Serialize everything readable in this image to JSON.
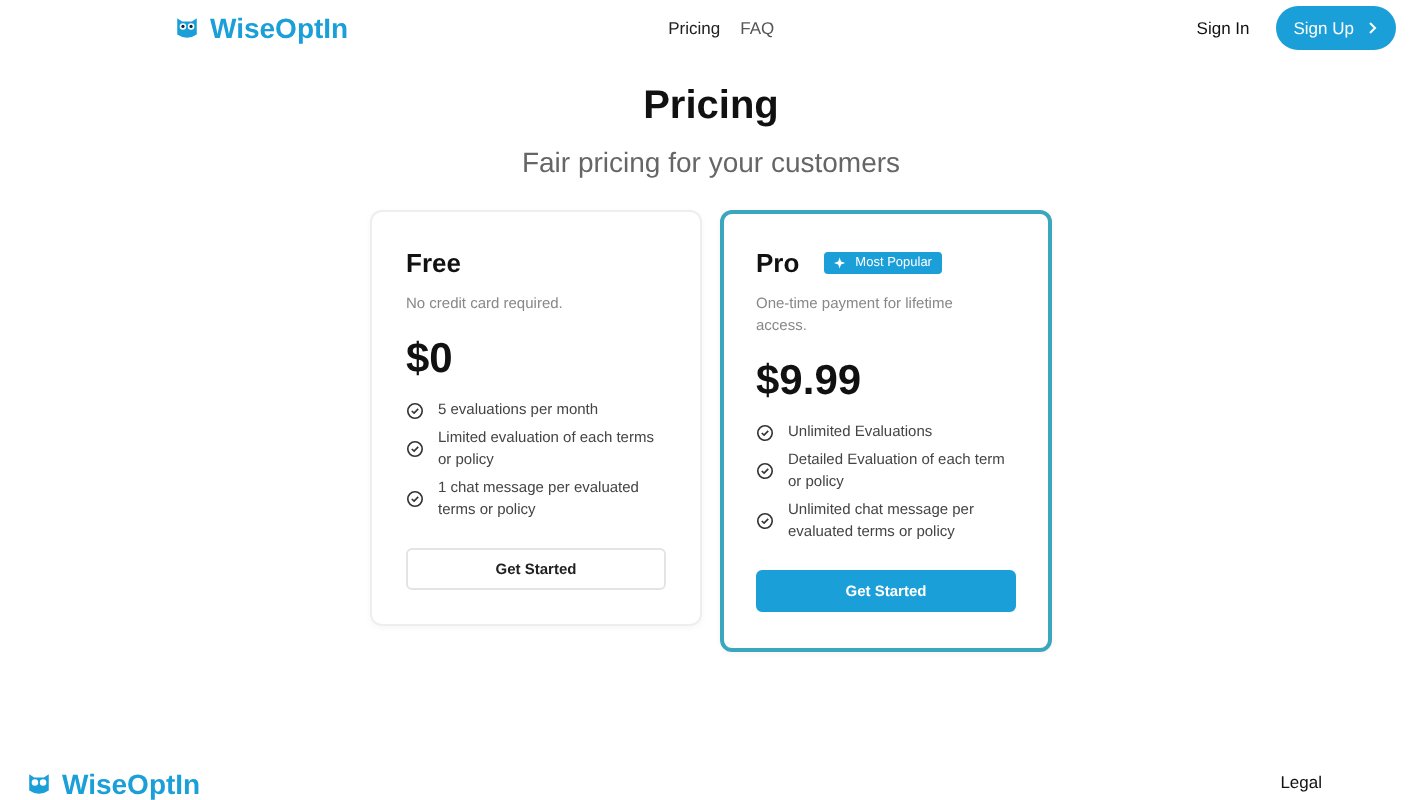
{
  "header": {
    "brand": "WiseOptIn",
    "nav": [
      {
        "label": "Pricing",
        "selected": true
      },
      {
        "label": "FAQ",
        "selected": false
      }
    ],
    "sign_in": "Sign In",
    "sign_up": "Sign Up"
  },
  "title": "Pricing",
  "subtitle": "Fair pricing for your customers",
  "plans": [
    {
      "name": "Free",
      "highlighted": false,
      "note": "No credit card required.",
      "price": "$0",
      "features": [
        "5 evaluations per month",
        "Limited evaluation of each terms or policy",
        "1 chat message per evaluated terms or policy"
      ],
      "button": "Get Started"
    },
    {
      "name": "Pro",
      "highlighted": true,
      "badge": "Most Popular",
      "note": "One-time payment for lifetime access.",
      "price": "$9.99",
      "features": [
        "Unlimited Evaluations",
        "Detailed Evaluation of each term or policy",
        "Unlimited chat message per evaluated terms or policy"
      ],
      "button": "Get Started"
    }
  ],
  "footer": {
    "brand": "WiseOptIn",
    "links": [
      "Legal"
    ]
  }
}
